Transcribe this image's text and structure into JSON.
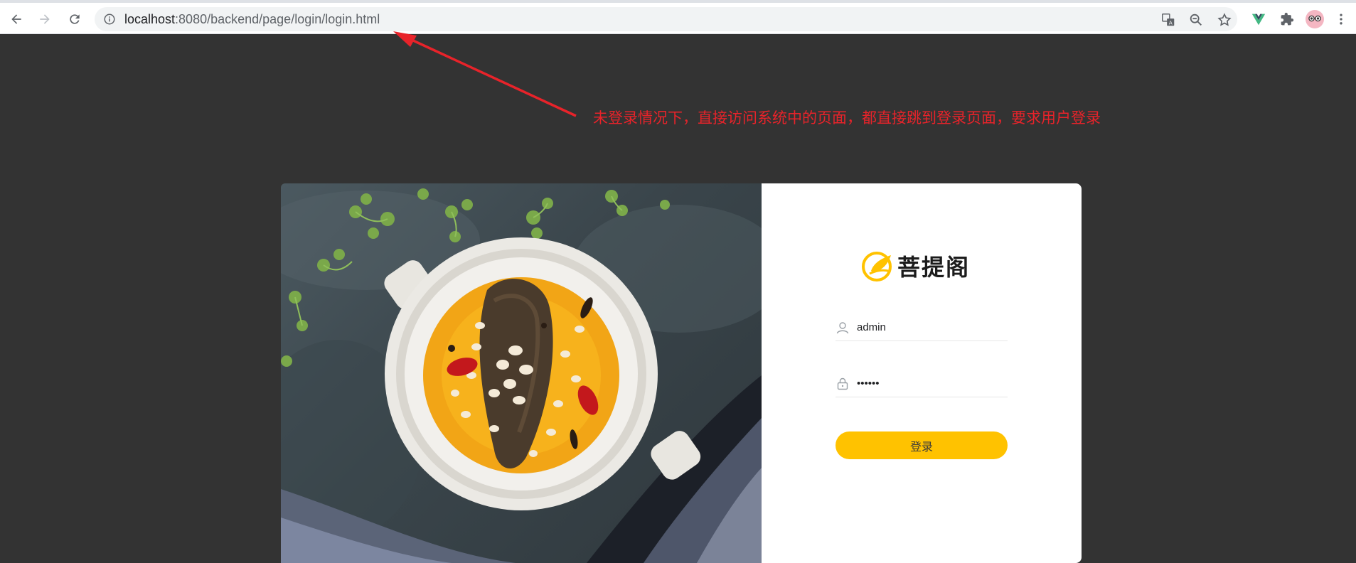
{
  "browser": {
    "url_host": "localhost",
    "url_rest": ":8080/backend/page/login/login.html",
    "icons": [
      "back-icon",
      "forward-icon",
      "reload-icon",
      "info-icon",
      "translate-icon",
      "zoom-out-icon",
      "bookmark-star-icon",
      "vue-devtools-icon",
      "extensions-icon",
      "profile-avatar-icon",
      "menu-icon"
    ]
  },
  "annotation": {
    "text": "未登录情况下，直接访问系统中的页面，都直接跳到登录页面，要求用户登录",
    "color": "#e8232a"
  },
  "login": {
    "brand_name": "菩提阁",
    "username_value": "admin",
    "password_value": "••••••",
    "submit_label": "登录",
    "accent_color": "#ffc200"
  }
}
